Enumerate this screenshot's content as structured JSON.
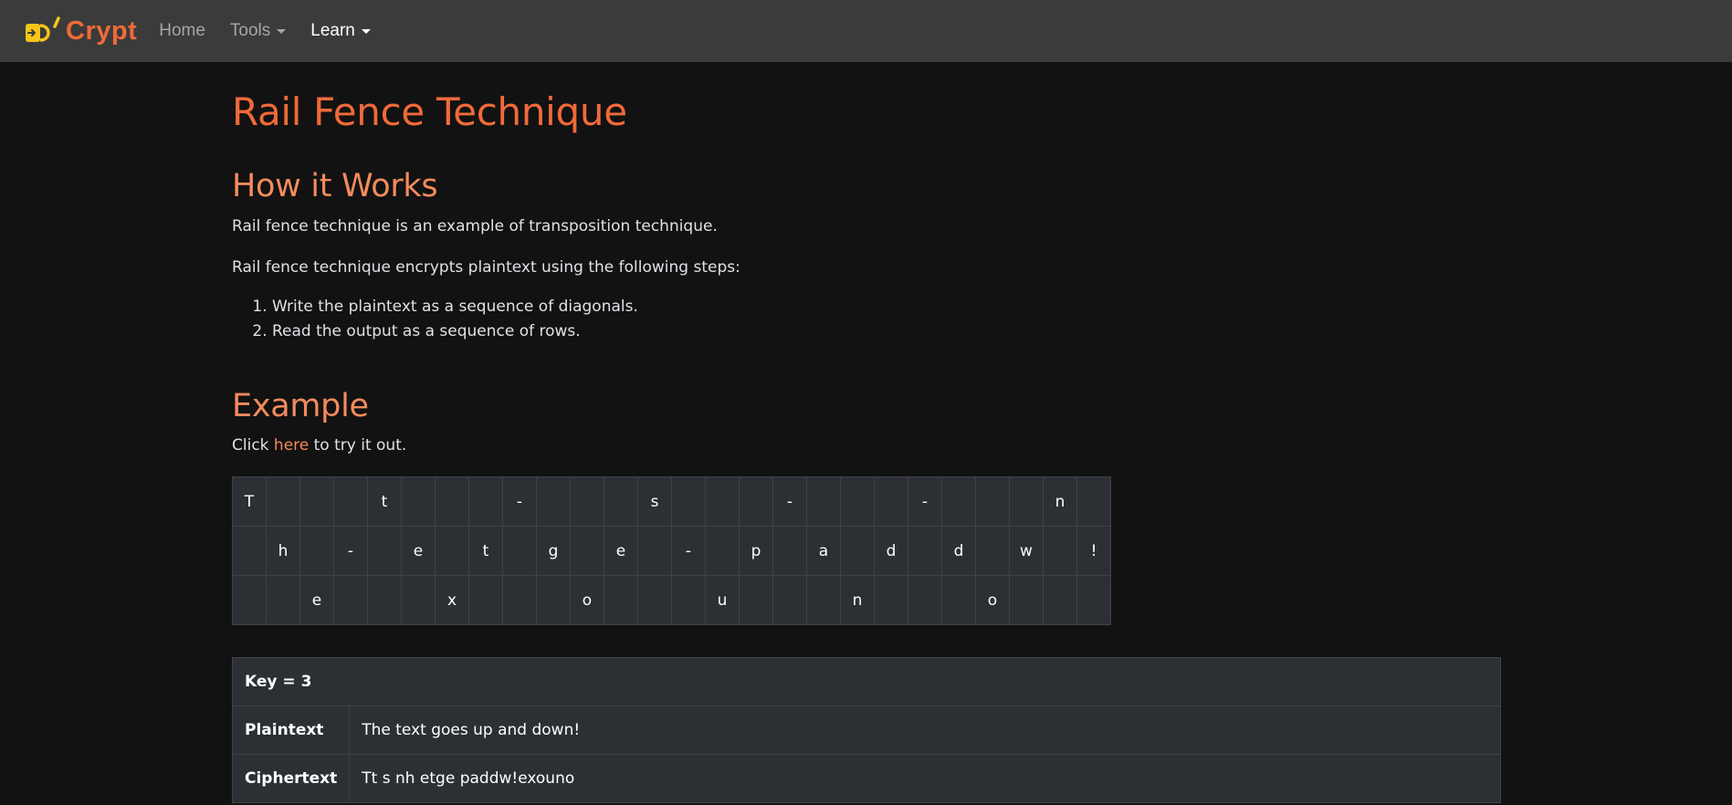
{
  "navbar": {
    "brand": "Crypt",
    "items": [
      {
        "label": "Home",
        "dropdown": false,
        "active": false
      },
      {
        "label": "Tools",
        "dropdown": true,
        "active": false
      },
      {
        "label": "Learn",
        "dropdown": true,
        "active": true
      }
    ]
  },
  "page": {
    "title": "Rail Fence Technique",
    "how_heading": "How it Works",
    "intro": "Rail fence technique is an example of transposition technique.",
    "steps_intro": "Rail fence technique encrypts plaintext using the following steps:",
    "steps": [
      "Write the plaintext as a sequence of diagonals.",
      "Read the output as a sequence of rows."
    ],
    "example_heading": "Example",
    "try_prefix": "Click ",
    "try_link": "here",
    "try_suffix": " to try it out."
  },
  "rail_grid": [
    [
      "T",
      "",
      "",
      "",
      "t",
      "",
      "",
      "",
      "-",
      "",
      "",
      "",
      "s",
      "",
      "",
      "",
      "-",
      "",
      "",
      "",
      "-",
      "",
      "",
      "",
      "n",
      ""
    ],
    [
      "",
      "h",
      "",
      "-",
      "",
      "e",
      "",
      "t",
      "",
      "g",
      "",
      "e",
      "",
      "-",
      "",
      "p",
      "",
      "a",
      "",
      "d",
      "",
      "d",
      "",
      "w",
      "",
      "!"
    ],
    [
      "",
      "",
      "e",
      "",
      "",
      "",
      "x",
      "",
      "",
      "",
      "o",
      "",
      "",
      "",
      "u",
      "",
      "",
      "",
      "n",
      "",
      "",
      "",
      "o",
      "",
      "",
      ""
    ]
  ],
  "info_table": {
    "key_label": "Key = 3",
    "plaintext_label": "Plaintext",
    "plaintext_value": "The text goes up and down!",
    "ciphertext_label": "Ciphertext",
    "ciphertext_value": "Tt s nh etge paddw!exouno"
  },
  "colors": {
    "accent": "#f06a3a",
    "heading": "#f28b5d",
    "logo_yellow": "#f5c518"
  }
}
